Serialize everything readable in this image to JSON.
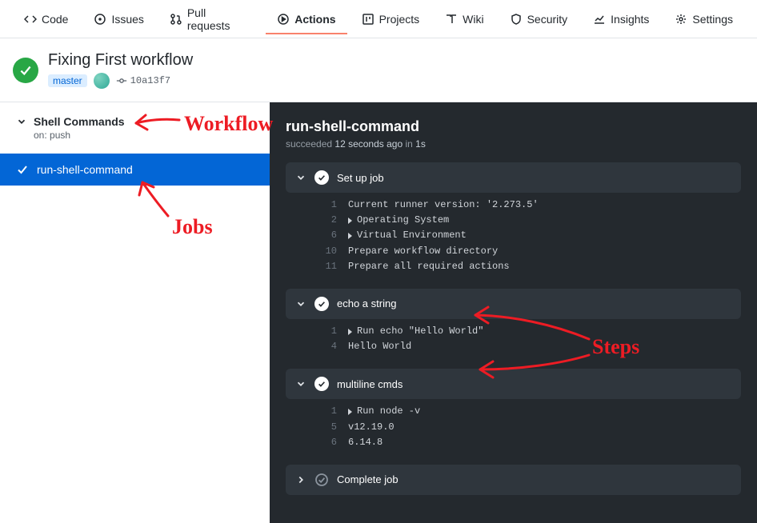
{
  "tabs": {
    "code": "Code",
    "issues": "Issues",
    "pulls": "Pull requests",
    "actions": "Actions",
    "projects": "Projects",
    "wiki": "Wiki",
    "security": "Security",
    "insights": "Insights",
    "settings": "Settings"
  },
  "run": {
    "title": "Fixing First workflow",
    "branch": "master",
    "sha": "10a13f7"
  },
  "sidebar": {
    "workflow_name": "Shell Commands",
    "trigger": "on: push",
    "job_name": "run-shell-command"
  },
  "log": {
    "title": "run-shell-command",
    "status_word": "succeeded",
    "ago": "12 seconds ago",
    "in_word": "in",
    "duration": "1s",
    "steps": [
      {
        "title": "Set up job",
        "expanded": true,
        "lines": [
          {
            "n": "1",
            "t": "Current runner version: '2.273.5'",
            "d": false
          },
          {
            "n": "2",
            "t": "Operating System",
            "d": true
          },
          {
            "n": "6",
            "t": "Virtual Environment",
            "d": true
          },
          {
            "n": "10",
            "t": "Prepare workflow directory",
            "d": false
          },
          {
            "n": "11",
            "t": "Prepare all required actions",
            "d": false
          }
        ]
      },
      {
        "title": "echo a string",
        "expanded": true,
        "lines": [
          {
            "n": "1",
            "t": "Run echo \"Hello World\"",
            "d": true
          },
          {
            "n": "4",
            "t": "Hello World",
            "d": false
          }
        ]
      },
      {
        "title": "multiline cmds",
        "expanded": true,
        "lines": [
          {
            "n": "1",
            "t": "Run node -v",
            "d": true
          },
          {
            "n": "5",
            "t": "v12.19.0",
            "d": false
          },
          {
            "n": "6",
            "t": "6.14.8",
            "d": false
          }
        ]
      },
      {
        "title": "Complete job",
        "expanded": false,
        "lines": []
      }
    ]
  },
  "annotations": {
    "workflow": "Workflow",
    "jobs": "Jobs",
    "steps": "Steps"
  }
}
